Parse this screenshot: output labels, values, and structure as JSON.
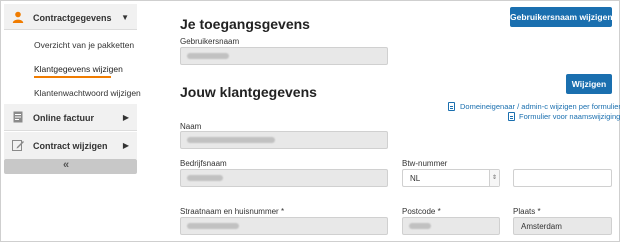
{
  "sidebar": {
    "groups": [
      {
        "label": "Contractgegevens",
        "icon": "user-icon"
      },
      {
        "label": "Online factuur",
        "icon": "invoice-icon"
      },
      {
        "label": "Contract wijzigen",
        "icon": "edit-icon"
      }
    ],
    "contract_items": [
      {
        "label": "Overzicht van je pakketten"
      },
      {
        "label": "Klantgegevens wijzigen",
        "active": true
      },
      {
        "label": "Klantenwachtwoord wijzigen"
      }
    ],
    "collapse_label": "«"
  },
  "access": {
    "title": "Je toegangsgevens",
    "change_username_button": "Gebruikersnaam wijzigen",
    "username_label": "Gebruikersnaam",
    "username_value": ""
  },
  "customer": {
    "title": "Jouw klantgegevens",
    "edit_button": "Wijzigen",
    "links": [
      {
        "label": "Domeineigenaar / admin-c wijzigen per formulier"
      },
      {
        "label": "Formulier voor naamswijziging"
      }
    ],
    "name_label": "Naam",
    "company_label": "Bedrijfsnaam",
    "vat_label": "Btw-nummer",
    "vat_country": "NL",
    "street_label": "Straatnaam en huisnummer *",
    "postcode_label": "Postcode *",
    "city_label": "Plaats *",
    "city_value": "Amsterdam"
  },
  "colors": {
    "accent": "#1a6faf",
    "active_underline": "#f07c00",
    "user_icon": "#f07c00"
  }
}
